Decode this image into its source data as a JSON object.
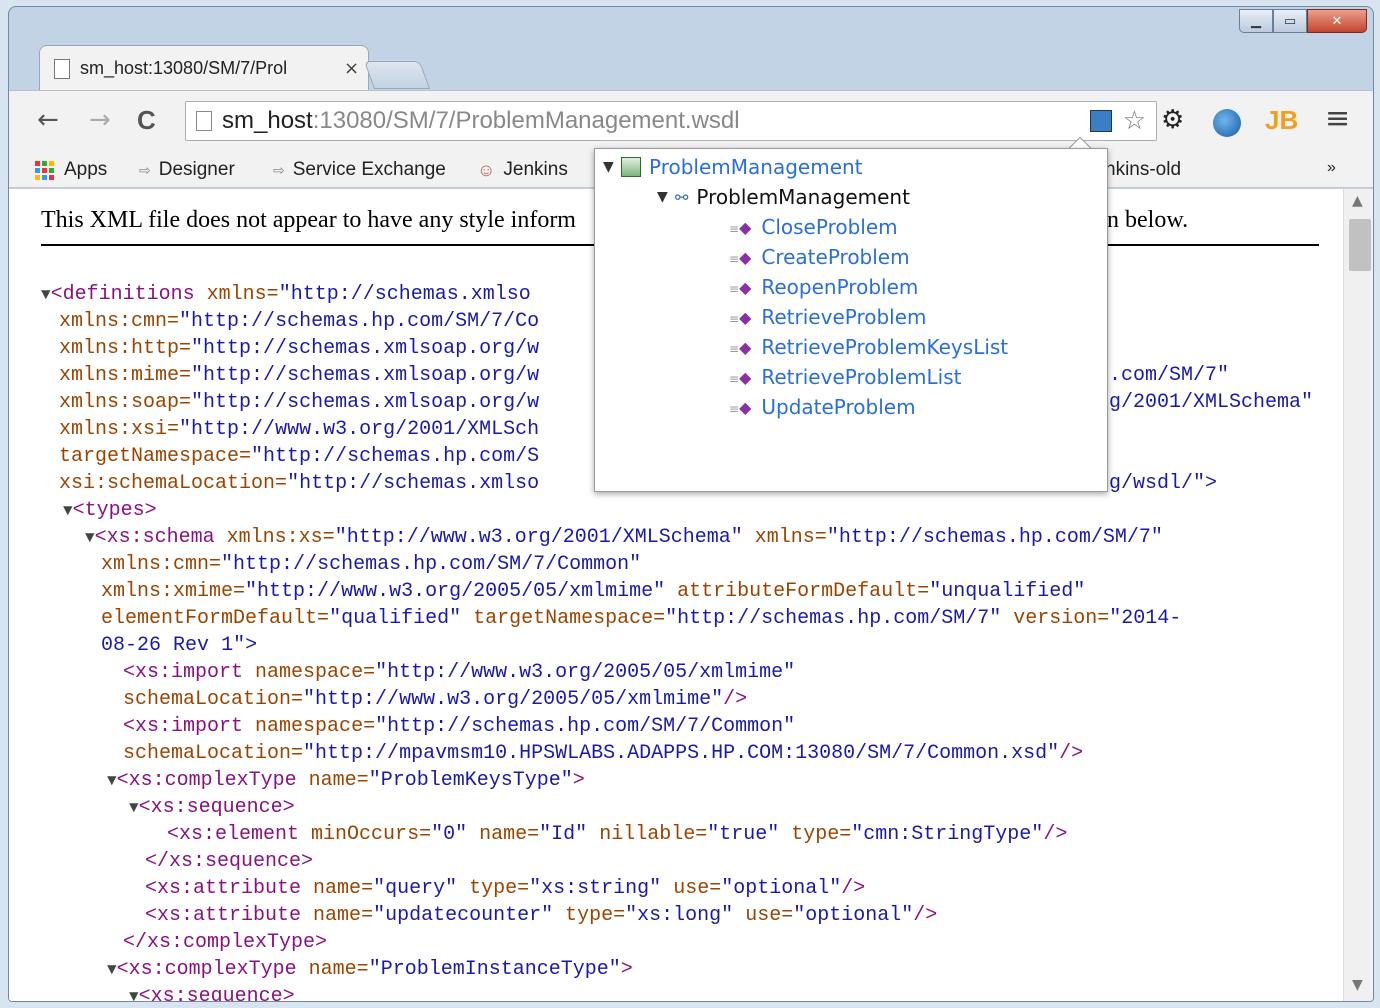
{
  "window": {
    "caption_buttons": {
      "minimize": "▁",
      "maximize": "▭",
      "close": "✕"
    }
  },
  "tab": {
    "title": "sm_host:13080/SM/7/Prol",
    "close": "×"
  },
  "toolbar": {
    "back": "←",
    "forward": "→",
    "reload": "C",
    "url_host": "sm_host",
    "url_rest": ":13080/SM/7/ProblemManagement.wsdl",
    "star": "☆",
    "gear": "⚙",
    "jb": "JB",
    "menu": "≡"
  },
  "bookmarks": {
    "items": [
      "Apps",
      "Designer",
      "Service Exchange",
      "Jenkins",
      "nkins-old"
    ],
    "more": "»"
  },
  "content": {
    "notice_left": "This XML file does not appear to have any style inform",
    "notice_right": "n below.",
    "xml_lines": [
      [
        "▼",
        "<definitions xmlns=\"http://schemas.xmlso"
      ],
      [
        "",
        "xmlns:cmn=\"http://schemas.hp.com/SM/7/Co"
      ],
      [
        "",
        "xmlns:http=\"http://schemas.xmlsoap.org/w"
      ],
      [
        "",
        "xmlns:mime=\"http://schemas.xmlsoap.org/w"
      ],
      [
        "",
        "xmlns:soap=\"http://schemas.xmlsoap.org/w"
      ],
      [
        "",
        "xmlns:xsi=\"http://www.w3.org/2001/XMLSch"
      ],
      [
        "",
        "targetNamespace=\"http://schemas.hp.com/S"
      ],
      [
        "",
        "xsi:schemaLocation=\"http://schemas.xmlso"
      ]
    ],
    "xml_right_fragments": [
      ".com/SM/7\"",
      "g/2001/XMLSchema\"",
      "g/wsdl/\">"
    ],
    "xml_body": [
      "▼<types>",
      "▼<xs:schema xmlns:xs=\"http://www.w3.org/2001/XMLSchema\" xmlns=\"http://schemas.hp.com/SM/7\"",
      "xmlns:cmn=\"http://schemas.hp.com/SM/7/Common\"",
      "xmlns:xmime=\"http://www.w3.org/2005/05/xmlmime\" attributeFormDefault=\"unqualified\"",
      "elementFormDefault=\"qualified\" targetNamespace=\"http://schemas.hp.com/SM/7\" version=\"2014-",
      "08-26 Rev 1\">",
      "<xs:import namespace=\"http://www.w3.org/2005/05/xmlmime\"",
      "schemaLocation=\"http://www.w3.org/2005/05/xmlmime\"/>",
      "<xs:import namespace=\"http://schemas.hp.com/SM/7/Common\"",
      "schemaLocation=\"http://mpavmsm10.HPSWLABS.ADAPPS.HP.COM:13080/SM/7/Common.xsd\"/>",
      "▼<xs:complexType name=\"ProblemKeysType\">",
      "▼<xs:sequence>",
      "<xs:element minOccurs=\"0\" name=\"Id\" nillable=\"true\" type=\"cmn:StringType\"/>",
      "</xs:sequence>",
      "<xs:attribute name=\"query\" type=\"xs:string\" use=\"optional\"/>",
      "<xs:attribute name=\"updatecounter\" type=\"xs:long\" use=\"optional\"/>",
      "</xs:complexType>",
      "▼<xs:complexType name=\"ProblemInstanceType\">",
      "▼<xs:sequence>"
    ]
  },
  "popup": {
    "service": "ProblemManagement",
    "port": "ProblemManagement",
    "operations": [
      "CloseProblem",
      "CreateProblem",
      "ReopenProblem",
      "RetrieveProblem",
      "RetrieveProblemKeysList",
      "RetrieveProblemList",
      "UpdateProblem"
    ]
  },
  "colors": {
    "tag": "#881280",
    "attr": "#994500",
    "value": "#1a1aa6",
    "link": "#2a6fd6"
  }
}
